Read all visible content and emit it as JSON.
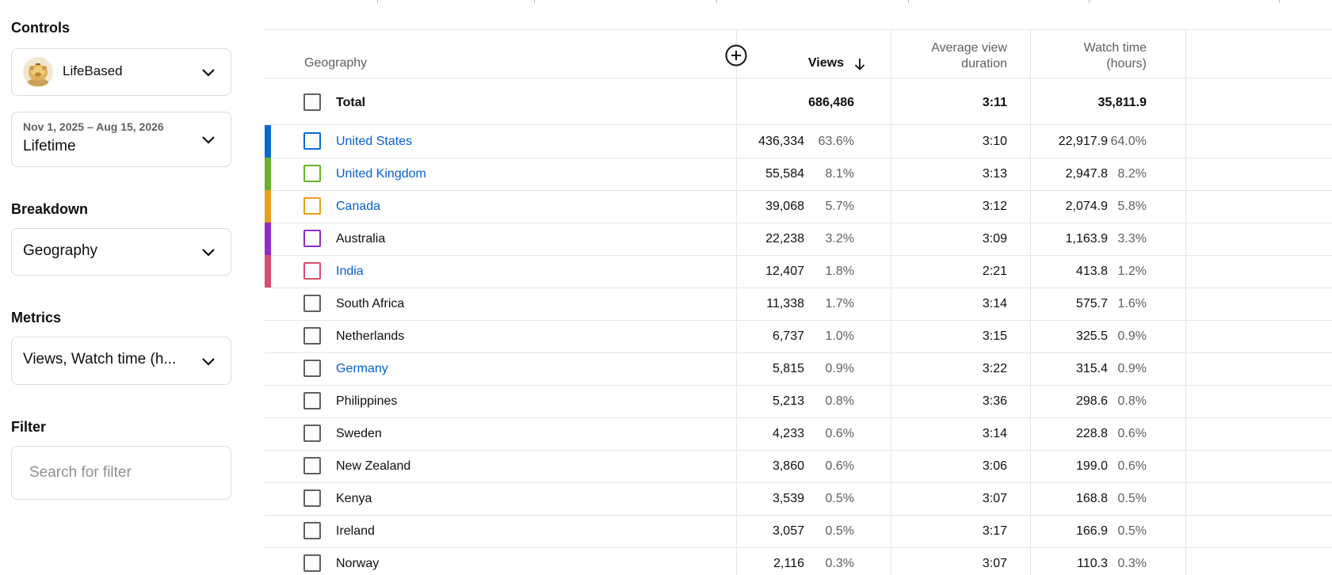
{
  "sidebar": {
    "controls_title": "Controls",
    "channel": {
      "name": "LifeBased",
      "avatar_icon": "piggy-bank-icon"
    },
    "date_range": {
      "range": "Nov 1, 2025 – Aug 15, 2026",
      "label": "Lifetime"
    },
    "breakdown_title": "Breakdown",
    "breakdown_value": "Geography",
    "metrics_title": "Metrics",
    "metrics_value": "Views, Watch time (h...",
    "filter_title": "Filter",
    "filter_placeholder": "Search for filter"
  },
  "table": {
    "headers": {
      "geography": "Geography",
      "views": "Views",
      "avg_duration_line1": "Average view",
      "avg_duration_line2": "duration",
      "watch_time_line1": "Watch time",
      "watch_time_line2": "(hours)"
    },
    "total": {
      "name": "Total",
      "views": "686,486",
      "avg_duration": "3:11",
      "watch_time": "35,811.9"
    },
    "rows": [
      {
        "name": "United States",
        "views": "436,334",
        "views_pct": "63.6%",
        "avg_duration": "3:10",
        "watch_time": "22,917.9",
        "watch_pct": "64.0%",
        "link": true,
        "color": "#0b6ad1"
      },
      {
        "name": "United Kingdom",
        "views": "55,584",
        "views_pct": "8.1%",
        "avg_duration": "3:13",
        "watch_time": "2,947.8",
        "watch_pct": "8.2%",
        "link": true,
        "color": "#65b32e"
      },
      {
        "name": "Canada",
        "views": "39,068",
        "views_pct": "5.7%",
        "avg_duration": "3:12",
        "watch_time": "2,074.9",
        "watch_pct": "5.8%",
        "link": true,
        "color": "#e6a019"
      },
      {
        "name": "Australia",
        "views": "22,238",
        "views_pct": "3.2%",
        "avg_duration": "3:09",
        "watch_time": "1,163.9",
        "watch_pct": "3.3%",
        "link": false,
        "color": "#8e2dc5"
      },
      {
        "name": "India",
        "views": "12,407",
        "views_pct": "1.8%",
        "avg_duration": "2:21",
        "watch_time": "413.8",
        "watch_pct": "1.2%",
        "link": true,
        "color": "#d64d6e"
      },
      {
        "name": "South Africa",
        "views": "11,338",
        "views_pct": "1.7%",
        "avg_duration": "3:14",
        "watch_time": "575.7",
        "watch_pct": "1.6%",
        "link": false,
        "color": ""
      },
      {
        "name": "Netherlands",
        "views": "6,737",
        "views_pct": "1.0%",
        "avg_duration": "3:15",
        "watch_time": "325.5",
        "watch_pct": "0.9%",
        "link": false,
        "color": ""
      },
      {
        "name": "Germany",
        "views": "5,815",
        "views_pct": "0.9%",
        "avg_duration": "3:22",
        "watch_time": "315.4",
        "watch_pct": "0.9%",
        "link": true,
        "color": ""
      },
      {
        "name": "Philippines",
        "views": "5,213",
        "views_pct": "0.8%",
        "avg_duration": "3:36",
        "watch_time": "298.6",
        "watch_pct": "0.8%",
        "link": false,
        "color": ""
      },
      {
        "name": "Sweden",
        "views": "4,233",
        "views_pct": "0.6%",
        "avg_duration": "3:14",
        "watch_time": "228.8",
        "watch_pct": "0.6%",
        "link": false,
        "color": ""
      },
      {
        "name": "New Zealand",
        "views": "3,860",
        "views_pct": "0.6%",
        "avg_duration": "3:06",
        "watch_time": "199.0",
        "watch_pct": "0.6%",
        "link": false,
        "color": ""
      },
      {
        "name": "Kenya",
        "views": "3,539",
        "views_pct": "0.5%",
        "avg_duration": "3:07",
        "watch_time": "168.8",
        "watch_pct": "0.5%",
        "link": false,
        "color": ""
      },
      {
        "name": "Ireland",
        "views": "3,057",
        "views_pct": "0.5%",
        "avg_duration": "3:17",
        "watch_time": "166.9",
        "watch_pct": "0.5%",
        "link": false,
        "color": ""
      },
      {
        "name": "Norway",
        "views": "2,116",
        "views_pct": "0.3%",
        "avg_duration": "3:07",
        "watch_time": "110.3",
        "watch_pct": "0.3%",
        "link": false,
        "color": ""
      }
    ]
  }
}
